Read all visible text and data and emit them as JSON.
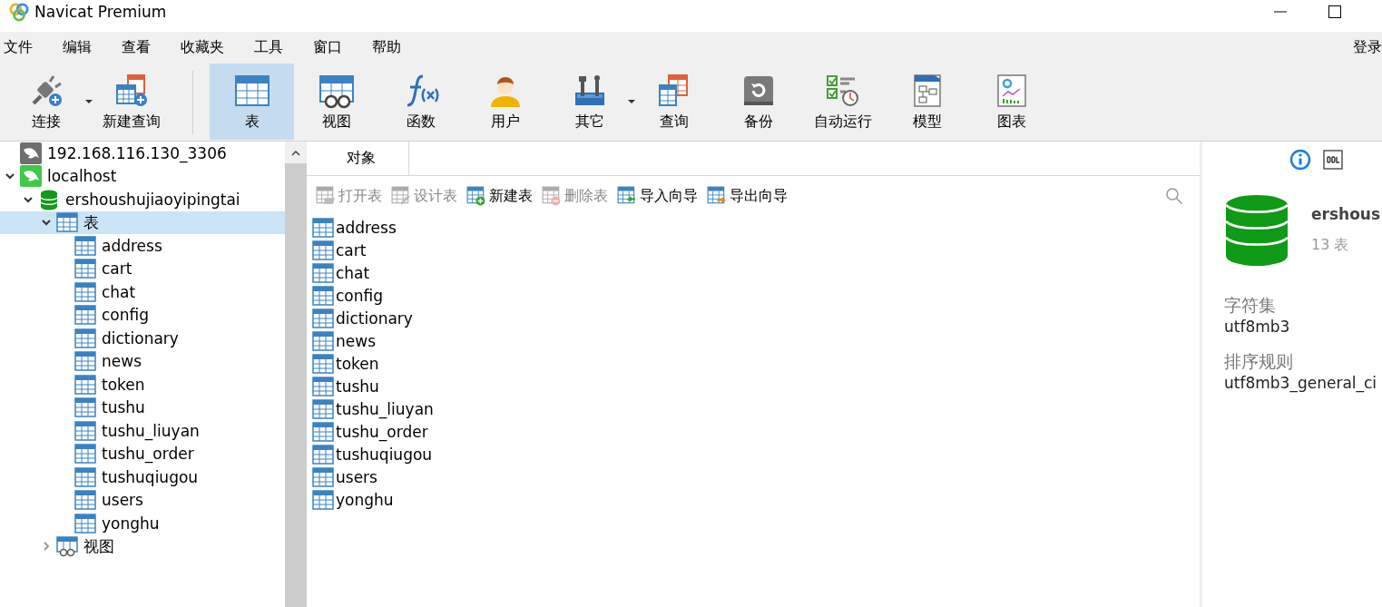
{
  "window": {
    "title": "Navicat Premium"
  },
  "menu": [
    "文件",
    "编辑",
    "查看",
    "收藏夹",
    "工具",
    "窗口",
    "帮助"
  ],
  "login": "登录",
  "toolbar": [
    {
      "kind": "connect",
      "label": "连接",
      "selected": false,
      "dropdown": true
    },
    {
      "kind": "newquery",
      "label": "新建查询",
      "selected": false,
      "dropdown": false
    },
    {
      "kind": "separator"
    },
    {
      "kind": "table",
      "label": "表",
      "selected": true,
      "dropdown": false
    },
    {
      "kind": "view",
      "label": "视图",
      "selected": false,
      "dropdown": false
    },
    {
      "kind": "function",
      "label": "函数",
      "selected": false,
      "dropdown": false
    },
    {
      "kind": "user",
      "label": "用户",
      "selected": false,
      "dropdown": false
    },
    {
      "kind": "tools",
      "label": "其它",
      "selected": false,
      "dropdown": true
    },
    {
      "kind": "query",
      "label": "查询",
      "selected": false,
      "dropdown": false
    },
    {
      "kind": "backup",
      "label": "备份",
      "selected": false,
      "dropdown": false
    },
    {
      "kind": "schedule",
      "label": "自动运行",
      "selected": false,
      "dropdown": false
    },
    {
      "kind": "model",
      "label": "模型",
      "selected": false,
      "dropdown": false
    },
    {
      "kind": "chart",
      "label": "图表",
      "selected": false,
      "dropdown": false
    }
  ],
  "tree": [
    {
      "kind": "connection",
      "label": "192.168.116.130_3306",
      "active": false,
      "selected": false
    },
    {
      "kind": "connection",
      "label": "localhost",
      "active": true,
      "expanded": true,
      "selected": false,
      "children": [
        {
          "kind": "database",
          "label": "ershoushujiaoyipingtai",
          "expanded": true,
          "selected": false,
          "children": [
            {
              "label": "表",
              "expanded": true,
              "selected": true,
              "children": [
                {
                  "label": "address",
                  "selected": false
                },
                {
                  "label": "cart",
                  "selected": false
                },
                {
                  "label": "chat",
                  "selected": false
                },
                {
                  "label": "config",
                  "selected": false
                },
                {
                  "label": "dictionary",
                  "selected": false
                },
                {
                  "label": "news",
                  "selected": false
                },
                {
                  "label": "token",
                  "selected": false
                },
                {
                  "label": "tushu",
                  "selected": false
                },
                {
                  "label": "tushu_liuyan",
                  "selected": false
                },
                {
                  "label": "tushu_order",
                  "selected": false
                },
                {
                  "label": "tushuqiugou",
                  "selected": false
                },
                {
                  "label": "users",
                  "selected": false
                },
                {
                  "label": "yonghu",
                  "selected": false
                }
              ]
            },
            {
              "kind": "views",
              "label": "视图",
              "expanded": false,
              "selected": false
            }
          ]
        }
      ]
    }
  ],
  "tabs": [
    {
      "label": "对象",
      "selected": true
    }
  ],
  "object_toolbar": [
    {
      "kind": "open",
      "label": "打开表",
      "disabled": true
    },
    {
      "kind": "design",
      "label": "设计表",
      "disabled": true
    },
    {
      "kind": "new",
      "label": "新建表",
      "disabled": false
    },
    {
      "kind": "delete",
      "label": "删除表",
      "disabled": true
    },
    {
      "kind": "import",
      "label": "导入向导",
      "disabled": false
    },
    {
      "kind": "export",
      "label": "导出向导",
      "disabled": false
    }
  ],
  "objects": [
    "address",
    "cart",
    "chat",
    "config",
    "dictionary",
    "news",
    "token",
    "tushu",
    "tushu_liuyan",
    "tushu_order",
    "tushuqiugou",
    "users",
    "yonghu"
  ],
  "info": {
    "name": "ershous",
    "count": "13 表",
    "fields": [
      {
        "label": "字符集",
        "value": "utf8mb3"
      },
      {
        "label": "排序规则",
        "value": "utf8mb3_general_ci"
      }
    ]
  }
}
